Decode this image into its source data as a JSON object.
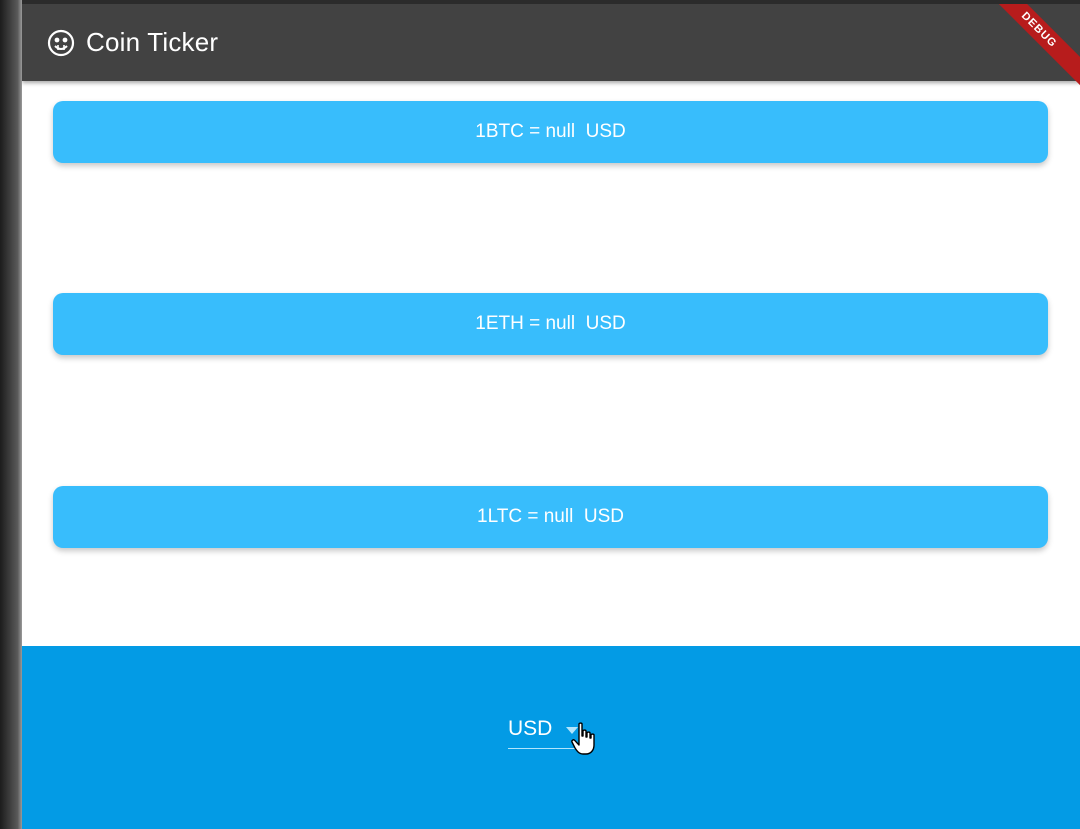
{
  "app": {
    "title": "Coin Ticker",
    "debug_banner": "DEBUG",
    "icon": "coin-icon"
  },
  "cards": [
    {
      "text": "1BTC = null  USD"
    },
    {
      "text": "1ETH = null  USD"
    },
    {
      "text": "1LTC = null  USD"
    }
  ],
  "currency_picker": {
    "selected": "USD"
  },
  "colors": {
    "appbar": "#424242",
    "card": "#38bdfc",
    "bottom_bar": "#039be5",
    "debug": "#b71c1c"
  }
}
